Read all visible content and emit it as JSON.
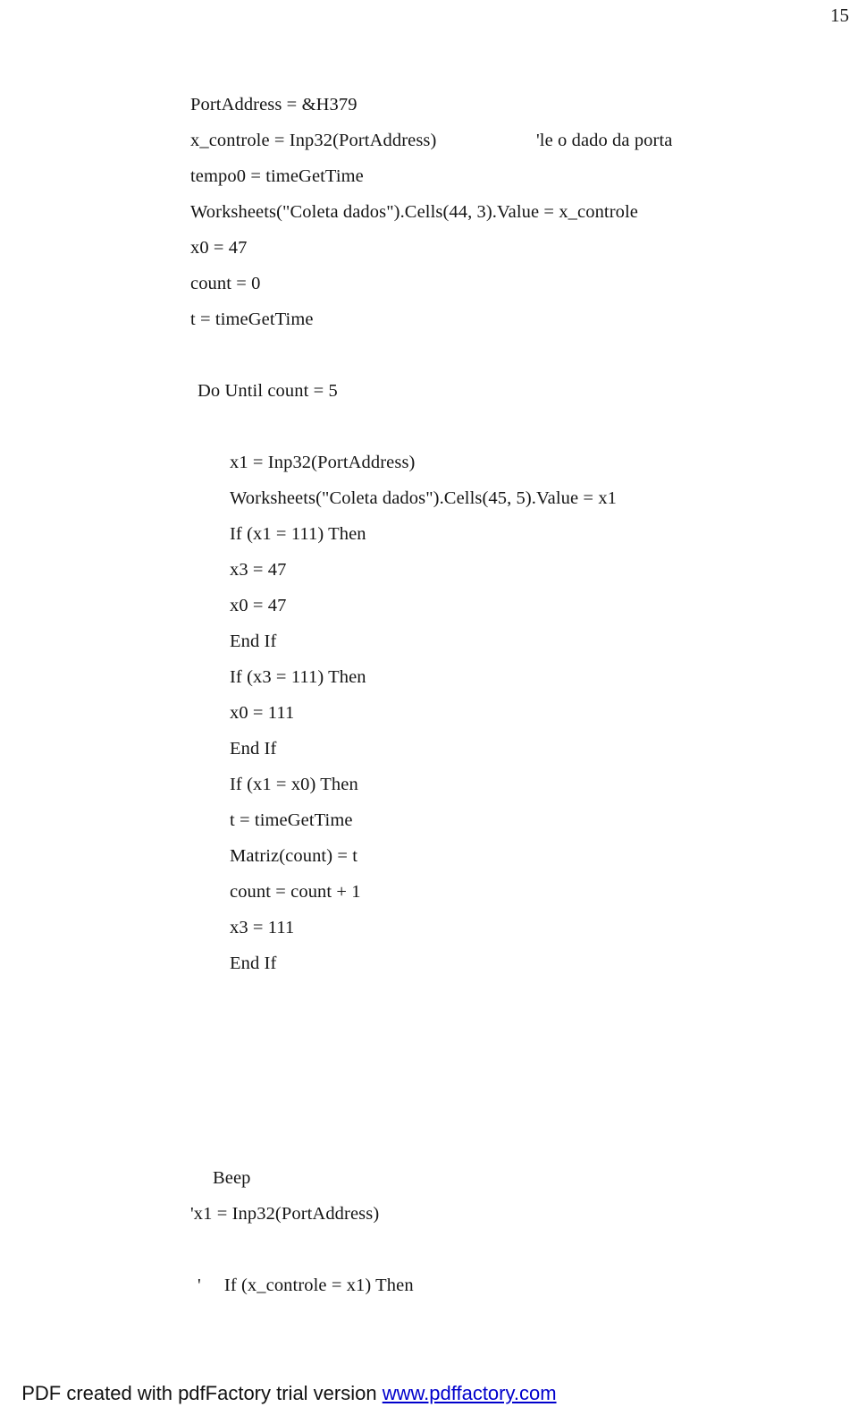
{
  "page": {
    "number": "15"
  },
  "code": {
    "lines": [
      {
        "indent": 0,
        "text": "PortAddress = &H379",
        "comment": ""
      },
      {
        "indent": 0,
        "text": "x_controle = Inp32(PortAddress)",
        "comment": "'le o dado da porta"
      },
      {
        "indent": 0,
        "text": "tempo0 = timeGetTime",
        "comment": ""
      },
      {
        "indent": 0,
        "text": "Worksheets(\"Coleta dados\").Cells(44, 3).Value = x_controle",
        "comment": ""
      },
      {
        "indent": 0,
        "text": "x0 = 47",
        "comment": ""
      },
      {
        "indent": 0,
        "text": "count = 0",
        "comment": ""
      },
      {
        "indent": 0,
        "text": "t = timeGetTime",
        "comment": ""
      },
      {
        "indent": 0,
        "text": "",
        "comment": ""
      },
      {
        "indent": 1,
        "text": "Do Until count = 5",
        "comment": ""
      },
      {
        "indent": 0,
        "text": "",
        "comment": ""
      },
      {
        "indent": 3,
        "text": "x1 = Inp32(PortAddress)",
        "comment": ""
      },
      {
        "indent": 3,
        "text": "Worksheets(\"Coleta dados\").Cells(45, 5).Value = x1",
        "comment": ""
      },
      {
        "indent": 3,
        "text": "If (x1 = 111) Then",
        "comment": ""
      },
      {
        "indent": 3,
        "text": "x3 = 47",
        "comment": ""
      },
      {
        "indent": 3,
        "text": "x0 = 47",
        "comment": ""
      },
      {
        "indent": 3,
        "text": "End If",
        "comment": ""
      },
      {
        "indent": 3,
        "text": "If (x3 = 111) Then",
        "comment": ""
      },
      {
        "indent": 3,
        "text": "x0 = 111",
        "comment": ""
      },
      {
        "indent": 3,
        "text": "End If",
        "comment": ""
      },
      {
        "indent": 3,
        "text": "If (x1 = x0) Then",
        "comment": ""
      },
      {
        "indent": 3,
        "text": "t = timeGetTime",
        "comment": ""
      },
      {
        "indent": 3,
        "text": "Matriz(count) = t",
        "comment": ""
      },
      {
        "indent": 3,
        "text": "count = count + 1",
        "comment": ""
      },
      {
        "indent": 3,
        "text": "x3 = 111",
        "comment": ""
      },
      {
        "indent": 3,
        "text": "End If",
        "comment": ""
      },
      {
        "indent": 0,
        "text": "",
        "comment": ""
      },
      {
        "indent": 0,
        "text": "",
        "comment": ""
      },
      {
        "indent": 0,
        "text": "",
        "comment": ""
      },
      {
        "indent": 0,
        "text": "",
        "comment": ""
      },
      {
        "indent": 0,
        "text": "",
        "comment": ""
      },
      {
        "indent": 2,
        "text": "Beep",
        "comment": ""
      },
      {
        "indent": 0,
        "text": "'x1 = Inp32(PortAddress)",
        "comment": ""
      },
      {
        "indent": 0,
        "text": "",
        "comment": ""
      },
      {
        "indent": 1,
        "text": "'     If (x_controle = x1) Then",
        "comment": ""
      }
    ]
  },
  "footer": {
    "text": "PDF created with pdfFactory trial version ",
    "url": "www.pdffactory.com",
    "url_color": "#0000cc"
  }
}
